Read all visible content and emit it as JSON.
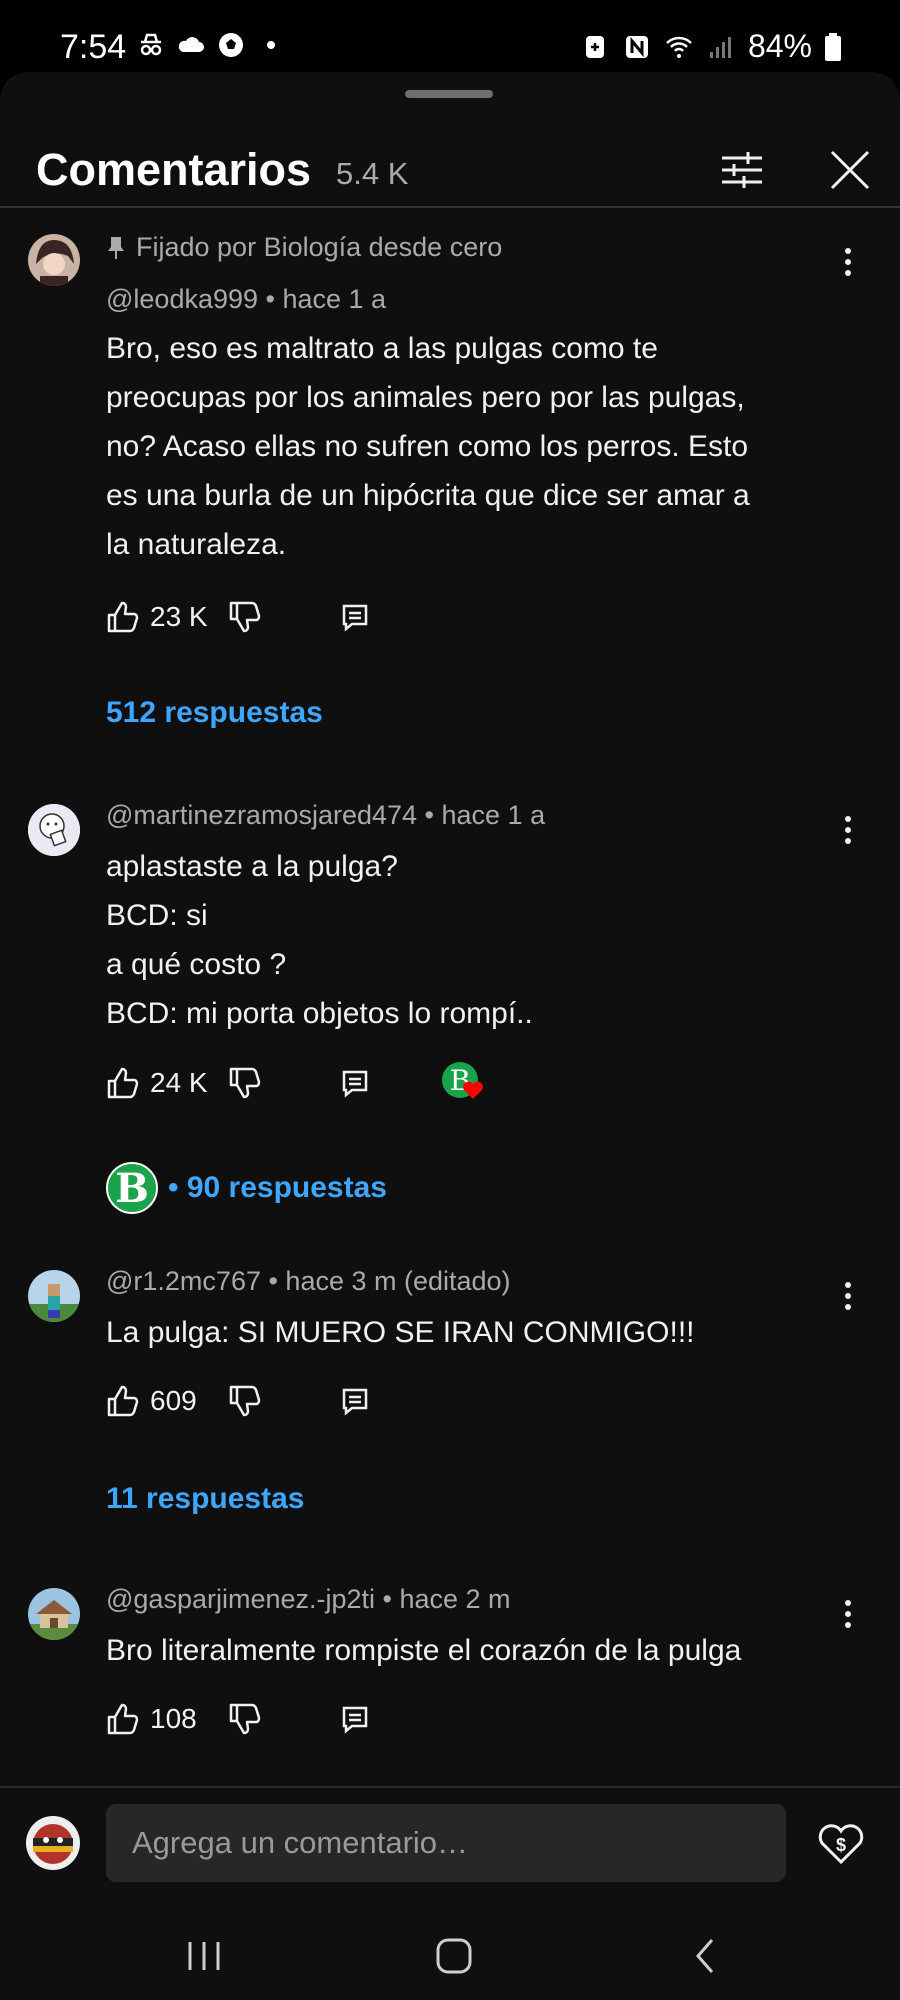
{
  "status_bar": {
    "time": "7:54",
    "battery": "84%",
    "left_icons": [
      "incognito-icon",
      "cloud-icon",
      "soccer-ball-icon",
      "dot-icon"
    ],
    "right_icons": [
      "battery-saver-icon",
      "nfc-icon",
      "wifi-icon",
      "signal-icon",
      "battery-icon"
    ]
  },
  "header": {
    "title": "Comentarios",
    "count": "5.4 K"
  },
  "comments": [
    {
      "pinned_label": "Fijado por Biología desde cero",
      "meta": "@leodka999 • hace 1 a",
      "lines": [
        "Bro, eso es maltrato a las pulgas como te",
        "preocupas por los animales pero por las pulgas,",
        "no? Acaso ellas no sufren como los perros. Esto",
        "es una burla de un hipócrita que dice ser amar a",
        "la naturaleza."
      ],
      "likes": "23 K",
      "replies": "512 respuestas"
    },
    {
      "meta": "@martinezramosjared474 • hace 1 a",
      "lines": [
        "aplastaste a la pulga?",
        "BCD: si",
        "a qué costo ?",
        "BCD: mi porta objetos lo rompí.."
      ],
      "likes": "24 K",
      "creator_letter": "B",
      "replies": "• 90 respuestas"
    },
    {
      "meta": "@r1.2mc767 • hace 3 m (editado)",
      "lines": [
        "La pulga: SI MUERO SE IRAN CONMIGO!!!"
      ],
      "likes": "609",
      "replies": "11 respuestas"
    },
    {
      "meta": "@gasparjimenez.-jp2ti • hace 2 m",
      "lines": [
        "Bro literalmente rompiste el corazón de la pulga"
      ],
      "likes": "108"
    }
  ],
  "input": {
    "placeholder": "Agrega un comentario…"
  },
  "colors": {
    "background": "#0f0f0f",
    "link": "#3ea6ff",
    "muted": "#aaaaaa",
    "creator_badge": "#1aa34a",
    "heart": "#ff0000"
  }
}
